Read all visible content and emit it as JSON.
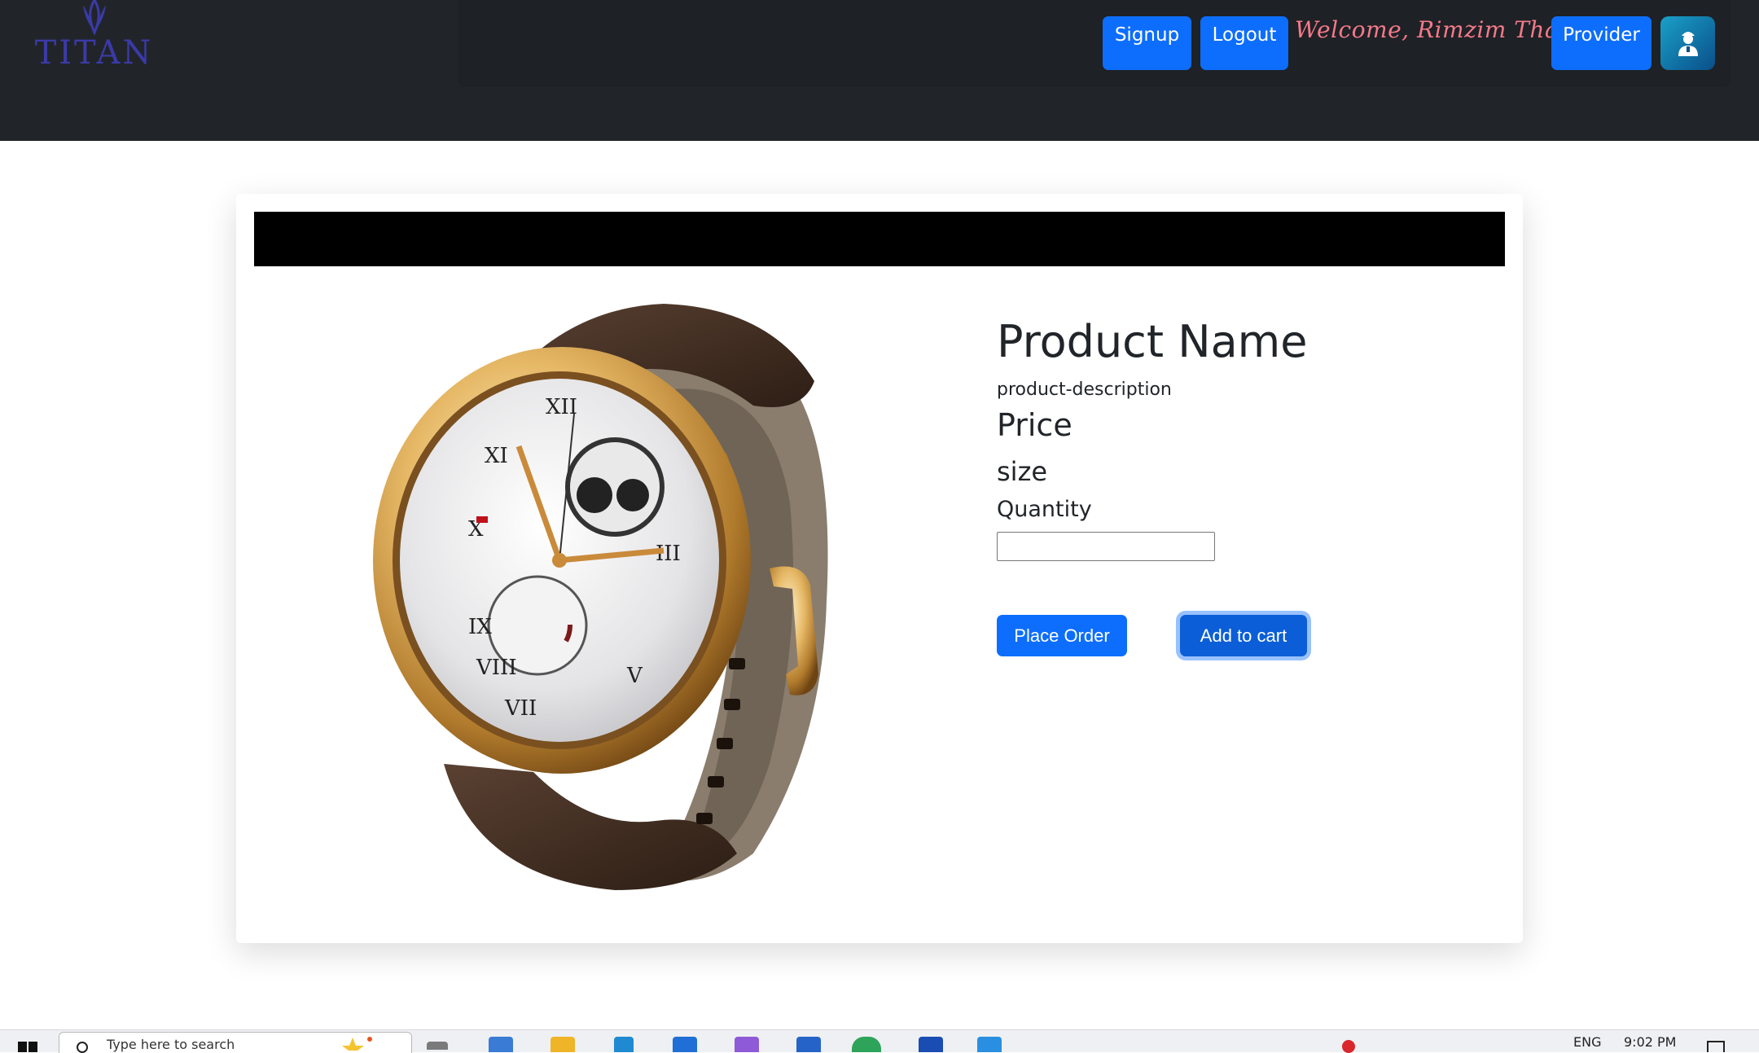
{
  "header": {
    "logo_text": "TITAN",
    "signup_label": "Signup",
    "logout_label": "Logout",
    "welcome_text": "Welcome, Rimzim Thakur",
    "provider_label": "Provider"
  },
  "product": {
    "name": "Product Name",
    "description": "product-description",
    "price_label": "Price",
    "size_label": "size",
    "quantity_label": "Quantity",
    "quantity_value": "",
    "place_order_label": "Place Order",
    "add_to_cart_label": "Add to cart"
  },
  "taskbar": {
    "search_placeholder": "Type here to search",
    "language": "ENG",
    "time": "9:02 PM"
  },
  "colors": {
    "navbar": "#212529",
    "primary": "#0d6efd",
    "welcome": "#f47a8a",
    "logo": "#3b3aa8"
  }
}
